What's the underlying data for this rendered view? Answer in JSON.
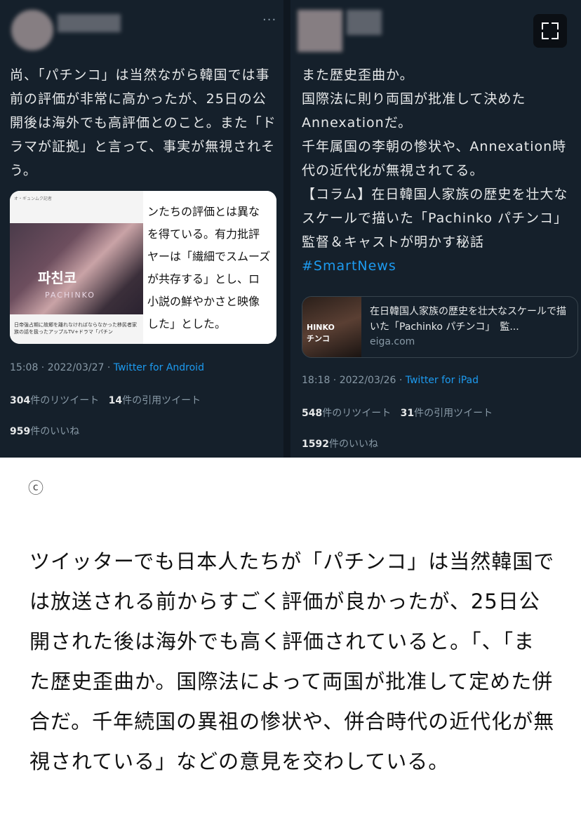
{
  "tweet1": {
    "more_label": "···",
    "body": "尚、「パチンコ」は当然ながら韓国では事前の評価が非常に高かったが、25日の公開後は海外でも高評価とのこと。また「ドラマが証拠」と言って、事実が無視されそう。",
    "media": {
      "top_label": "オ・ギュンムク記者",
      "poster_title": "파친코",
      "poster_sub": "PACHINKO",
      "caption": "日帝強占期に故郷を離れなければならなかった移民者家族の話を扱ったアップルTV+ドラマ「パチン",
      "right_text": "ンたちの評価とは異な\nを得ている。有力批評\nヤーは「繊細でスムーズ\nが共存する」とし、ロ\n小説の鮮やかさと映像\nした」とした。"
    },
    "time": "15:08 · 2022/03/27 · ",
    "client": "Twitter for Android",
    "retweets_num": "304",
    "retweets_label": "件のリツイート",
    "quotes_num": "14",
    "quotes_label": "件の引用ツイート",
    "likes_num": "959",
    "likes_label": "件のいいね"
  },
  "tweet2": {
    "body": "また歴史歪曲か。\n国際法に則り両国が批准して決めたAnnexationだ。\n千年属国の李朝の惨状や、Annexation時代の近代化が無視されてる。",
    "shared_text": "【コラム】在日韓国人家族の歴史を壮大なスケールで描いた「Pachinko パチンコ」　監督＆キャストが明かす秘話 ",
    "hashtag": "#SmartNews",
    "card": {
      "thumb_text": "HINKO\nチンコ",
      "title": "在日韓国人家族の歴史を壮大なスケールで描いた「Pachinko パチンコ」　監...",
      "domain": "eiga.com"
    },
    "time": "18:18 · 2022/03/26 · ",
    "client": "Twitter for iPad",
    "retweets_num": "548",
    "retweets_label": "件のリツイート",
    "quotes_num": "31",
    "quotes_label": "件の引用ツイート",
    "likes_num": "1592",
    "likes_label": "件のいいね"
  },
  "copyright": "ⓒ",
  "article": "ツイッターでも日本人たちが「パチンコ」は当然韓国では放送される前からすごく評価が良かったが、25日公開された後は海外でも高く評価されていると。「、「また歴史歪曲か。国際法によって両国が批准して定めた併合だ。千年続国の異祖の惨状や、併合時代の近代化が無視されている」などの意見を交わしている。"
}
